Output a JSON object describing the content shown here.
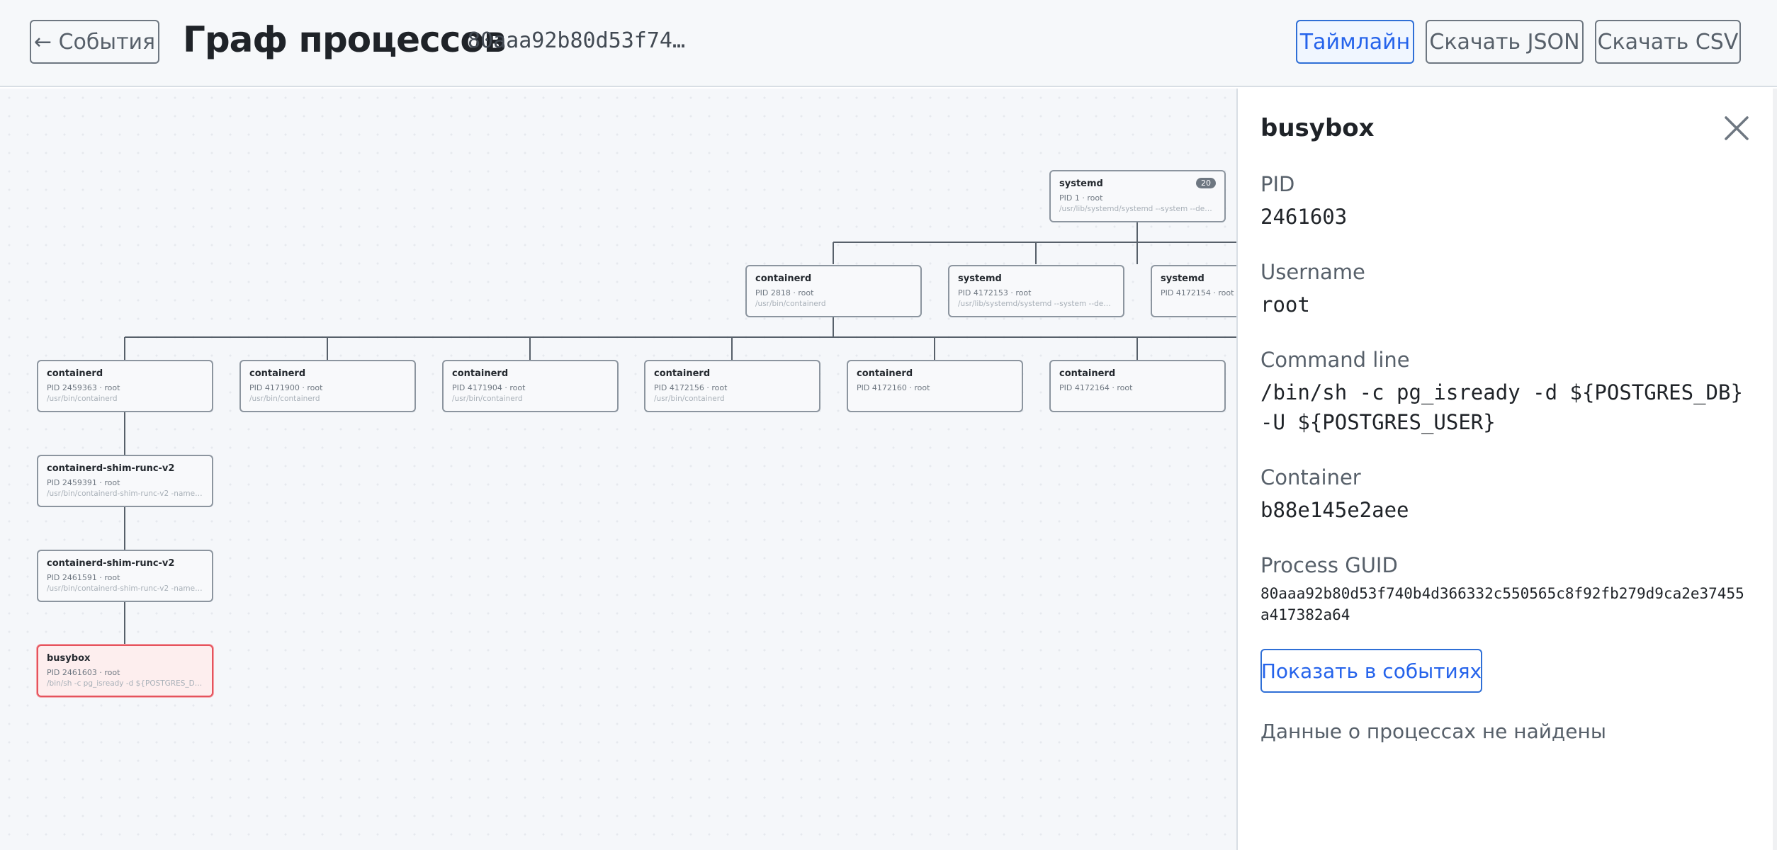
{
  "header": {
    "back_label": "← События",
    "title": "Граф процессов",
    "guid_short": "80aaa92b80d53f74…",
    "timeline_label": "Таймлайн",
    "download_json_label": "Скачать JSON",
    "download_csv_label": "Скачать CSV"
  },
  "graph": {
    "nodes": [
      {
        "name": "systemd",
        "pid_user": "PID 1 · root",
        "cmd": "/usr/lib/systemd/systemd --system --deseriali...",
        "badge": "20"
      },
      {
        "name": "containerd",
        "pid_user": "PID 2818 · root",
        "cmd": "/usr/bin/containerd"
      },
      {
        "name": "systemd",
        "pid_user": "PID 4172153 · root",
        "cmd": "/usr/lib/systemd/systemd --system --deseriali..."
      },
      {
        "name": "systemd",
        "pid_user": "PID 4172154 · root",
        "cmd": ""
      },
      {
        "name": "containerd",
        "pid_user": "PID 2459363 · root",
        "cmd": "/usr/bin/containerd"
      },
      {
        "name": "containerd",
        "pid_user": "PID 4171900 · root",
        "cmd": "/usr/bin/containerd"
      },
      {
        "name": "containerd",
        "pid_user": "PID 4171904 · root",
        "cmd": "/usr/bin/containerd"
      },
      {
        "name": "containerd",
        "pid_user": "PID 4172156 · root",
        "cmd": "/usr/bin/containerd"
      },
      {
        "name": "containerd",
        "pid_user": "PID 4172160 · root",
        "cmd": ""
      },
      {
        "name": "containerd",
        "pid_user": "PID 4172164 · root",
        "cmd": ""
      },
      {
        "name": "containerd-shim-runc-v2",
        "pid_user": "PID 2459391 · root",
        "cmd": "/usr/bin/containerd-shim-runc-v2 -namespac..."
      },
      {
        "name": "containerd-shim-runc-v2",
        "pid_user": "PID 2461591 · root",
        "cmd": "/usr/bin/containerd-shim-runc-v2 -namespac..."
      },
      {
        "name": "busybox",
        "pid_user": "PID 2461603 · root",
        "cmd": "/bin/sh -c pg_isready -d ${POSTGRES_DB} -..."
      }
    ]
  },
  "details": {
    "title": "busybox",
    "pid_label": "PID",
    "pid_value": "2461603",
    "username_label": "Username",
    "username_value": "root",
    "cmdline_label": "Command line",
    "cmdline_value": "/bin/sh -c pg_isready -d ${POSTGRES_DB} -U ${POSTGRES_USER}",
    "container_label": "Container",
    "container_value": "b88e145e2aee",
    "guid_label": "Process GUID",
    "guid_value": "80aaa92b80d53f740b4d366332c550565c8f92fb279d9ca2e37455a417382a64",
    "show_in_events_label": "Показать в событиях",
    "empty_message": "Данные о процессах не найдены"
  },
  "colors": {
    "accent": "#2563eb",
    "selected_border": "#e5535d",
    "selected_bg": "#fdeeee"
  }
}
